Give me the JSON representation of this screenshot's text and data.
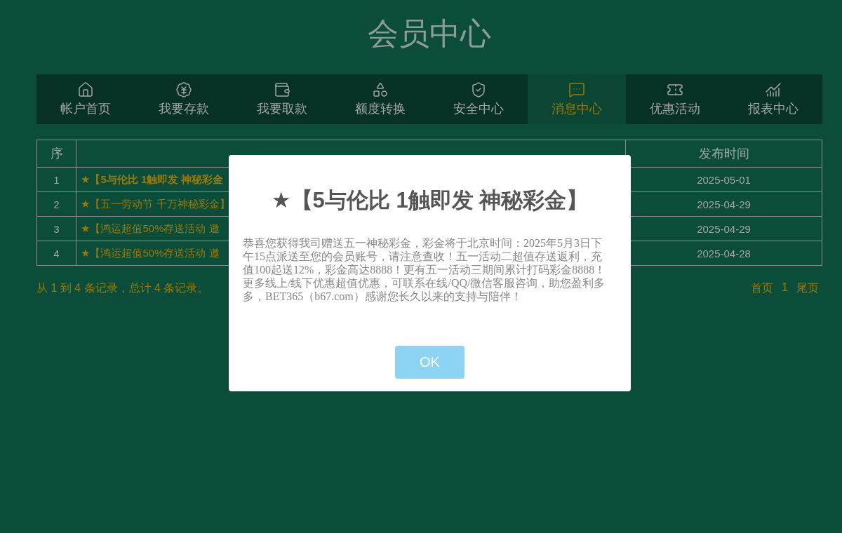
{
  "page_title": "会员中心",
  "nav": [
    {
      "label": "帐户首页",
      "selected": false
    },
    {
      "label": "我要存款",
      "selected": false
    },
    {
      "label": "我要取款",
      "selected": false
    },
    {
      "label": "额度转换",
      "selected": false
    },
    {
      "label": "安全中心",
      "selected": false
    },
    {
      "label": "消息中心",
      "selected": true
    },
    {
      "label": "优惠活动",
      "selected": false
    },
    {
      "label": "报表中心",
      "selected": false
    }
  ],
  "table": {
    "columns": [
      "序",
      "发布时间"
    ],
    "rows": [
      {
        "index": "1",
        "content": "★【5与伦比 1触即发 神秘彩金",
        "time": "2025-05-01",
        "bold": true
      },
      {
        "index": "2",
        "content": "★【五一劳动节 千万神秘彩金】",
        "time": "2025-04-29",
        "bold": false
      },
      {
        "index": "3",
        "content": "★【鸿运超值50%存送活动 邀",
        "time": "2025-04-29",
        "bold": false
      },
      {
        "index": "4",
        "content": "★【鸿运超值50%存送活动 邀",
        "time": "2025-04-28",
        "bold": false
      }
    ]
  },
  "summary": "从 1 到 4 条记录，总计 4 条记录。",
  "pager": {
    "first": "首页",
    "current": "1",
    "last": "尾页"
  },
  "dialog": {
    "title": "★【5与伦比 1触即发 神秘彩金】",
    "body": "恭喜您获得我司赠送五一神秘彩金，彩金将于北京时间：2025年5月3日下午15点派送至您的会员账号，请注意查收！五一活动二超值存送返利，充值100起送12%，彩金高达8888！更有五一活动三期间累计打码彩金8888！更多线上/线下优惠超值优惠，可联系在线/QQ/微信客服咨询，助您盈利多多，BET365（b67.com）感谢您长久以来的支持与陪伴！",
    "button": "OK"
  }
}
